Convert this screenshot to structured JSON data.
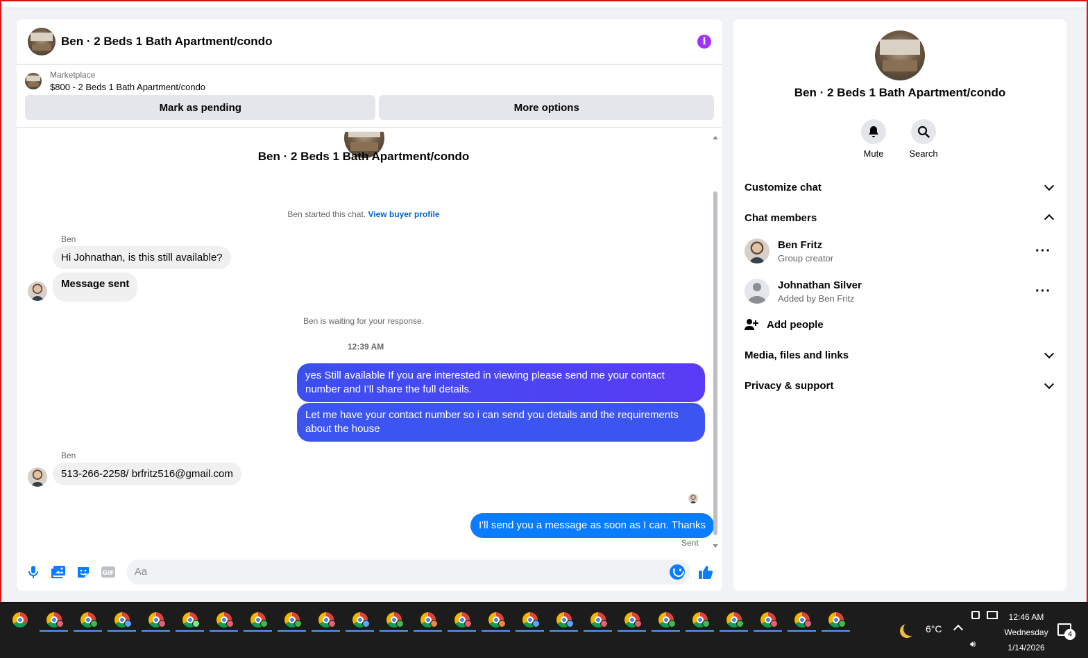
{
  "colors": {
    "accent": "#0a7cff",
    "outgoing_gradient": "#4b48f2",
    "info": "#a033ff",
    "taskbar": "#1c1c1c"
  },
  "chat": {
    "header_title": "Ben · 2 Beds 1 Bath Apartment/condo",
    "marketplace_label": "Marketplace",
    "listing_title": "$800 - 2 Beds 1 Bath Apartment/condo",
    "mark_pending": "Mark as pending",
    "more_options": "More options",
    "thread_title": "Ben · 2 Beds 1 Bath Apartment/condo",
    "started_note": "Ben started this chat. ",
    "view_profile": "View buyer profile",
    "messages": [
      {
        "sender": "Ben",
        "text": "Hi Johnathan, is this still available?"
      },
      {
        "text": "Message sent"
      },
      {
        "note": "Ben is waiting for your response."
      },
      {
        "timestamp": "12:39 AM"
      },
      {
        "out": "yes Still available If you are interested in viewing please send me your contact number and I’ll share the full details."
      },
      {
        "out": "Let me have your contact number so i can send you details and the requirements about the house"
      },
      {
        "sender": "Ben",
        "text": "513-266-2258/ brfritz516@gmail.com"
      },
      {
        "out": "I'll send you a message as soon as I can. Thanks"
      }
    ],
    "sent_label": "Sent",
    "composer_placeholder": "Aa"
  },
  "info": {
    "title": "Ben · 2 Beds 1 Bath Apartment/condo",
    "mute": "Mute",
    "search": "Search",
    "customize": "Customize chat",
    "members_heading": "Chat members",
    "members": [
      {
        "name": "Ben Fritz",
        "role": "Group creator"
      },
      {
        "name": "Johnathan Silver",
        "role": "Added by Ben Fritz"
      }
    ],
    "add_people": "Add people",
    "media": "Media, files and links",
    "privacy": "Privacy & support"
  },
  "taskbar": {
    "weather_temp": "6°C",
    "time": "12:46 AM",
    "day": "Wednesday",
    "date": "1/14/2026",
    "notifications": "4"
  }
}
